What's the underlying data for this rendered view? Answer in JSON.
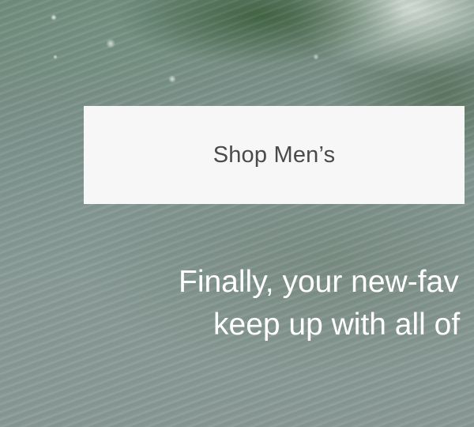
{
  "hero": {
    "background_image": "ocean-wave",
    "shop_button_label": "Shop Men’s",
    "tagline_line_1": "Finally, your new-fav",
    "tagline_line_2": "keep up with all of"
  },
  "colors": {
    "button_background": "#f7f7f7",
    "button_text": "#4a4a4a",
    "tagline_text": "#ffffff"
  }
}
